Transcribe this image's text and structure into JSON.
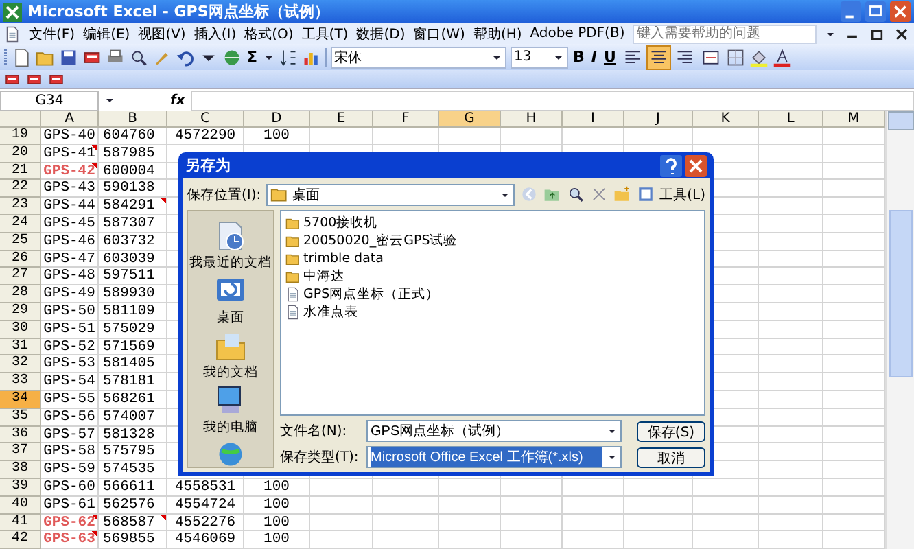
{
  "window": {
    "title": "Microsoft Excel - GPS网点坐标（试例）"
  },
  "menu": [
    "文件(F)",
    "编辑(E)",
    "视图(V)",
    "插入(I)",
    "格式(O)",
    "工具(T)",
    "数据(D)",
    "窗口(W)",
    "帮助(H)",
    "Adobe PDF(B)"
  ],
  "help_search": {
    "placeholder": "键入需要帮助的问题"
  },
  "standard_toolbar": {
    "sum_label": "Σ"
  },
  "formatting_toolbar": {
    "font": "宋体",
    "size": "13",
    "styles": [
      "B",
      "I",
      "U"
    ],
    "alignment": [
      {
        "selected": false
      },
      {
        "selected": true
      },
      {
        "selected": false
      },
      {
        "selected": false
      }
    ]
  },
  "formula_bar": {
    "name_box": "G34",
    "function_label": "fx"
  },
  "columns": [
    {
      "label": "A",
      "selected": false
    },
    {
      "label": "B",
      "selected": false
    },
    {
      "label": "C",
      "selected": false
    },
    {
      "label": "D",
      "selected": false
    },
    {
      "label": "E",
      "selected": false
    },
    {
      "label": "F",
      "selected": false
    },
    {
      "label": "G",
      "selected": true
    },
    {
      "label": "H",
      "selected": false
    },
    {
      "label": "I",
      "selected": false
    },
    {
      "label": "J",
      "selected": false
    },
    {
      "label": "K",
      "selected": false
    },
    {
      "label": "L",
      "selected": false
    },
    {
      "label": "M",
      "selected": false
    }
  ],
  "rows": [
    {
      "number": "19",
      "selected": false,
      "red": false,
      "cells": [
        {
          "text": "GPS-40",
          "comment": false
        },
        {
          "text": "604760",
          "comment": false
        },
        {
          "text": "4572290",
          "comment": false
        },
        {
          "text": "100",
          "comment": false
        }
      ]
    },
    {
      "number": "20",
      "selected": false,
      "red": false,
      "cells": [
        {
          "text": "GPS-41",
          "comment": true
        },
        {
          "text": "587985",
          "comment": false
        }
      ]
    },
    {
      "number": "21",
      "selected": false,
      "red": true,
      "cells": [
        {
          "text": "GPS-42",
          "comment": true
        },
        {
          "text": "600004",
          "comment": false
        }
      ]
    },
    {
      "number": "22",
      "selected": false,
      "red": false,
      "cells": [
        {
          "text": "GPS-43",
          "comment": false
        },
        {
          "text": "590138",
          "comment": false
        }
      ]
    },
    {
      "number": "23",
      "selected": false,
      "red": false,
      "cells": [
        {
          "text": "GPS-44",
          "comment": false
        },
        {
          "text": "584291",
          "comment": true
        }
      ]
    },
    {
      "number": "24",
      "selected": false,
      "red": false,
      "cells": [
        {
          "text": "GPS-45",
          "comment": false
        },
        {
          "text": "587307",
          "comment": false
        }
      ]
    },
    {
      "number": "25",
      "selected": false,
      "red": false,
      "cells": [
        {
          "text": "GPS-46",
          "comment": false
        },
        {
          "text": "603732",
          "comment": false
        }
      ]
    },
    {
      "number": "26",
      "selected": false,
      "red": false,
      "cells": [
        {
          "text": "GPS-47",
          "comment": false
        },
        {
          "text": "603039",
          "comment": false
        }
      ]
    },
    {
      "number": "27",
      "selected": false,
      "red": false,
      "cells": [
        {
          "text": "GPS-48",
          "comment": false
        },
        {
          "text": "597511",
          "comment": false
        }
      ]
    },
    {
      "number": "28",
      "selected": false,
      "red": false,
      "cells": [
        {
          "text": "GPS-49",
          "comment": false
        },
        {
          "text": "589930",
          "comment": false
        }
      ]
    },
    {
      "number": "29",
      "selected": false,
      "red": false,
      "cells": [
        {
          "text": "GPS-50",
          "comment": false
        },
        {
          "text": "581109",
          "comment": false
        }
      ]
    },
    {
      "number": "30",
      "selected": false,
      "red": false,
      "cells": [
        {
          "text": "GPS-51",
          "comment": false
        },
        {
          "text": "575029",
          "comment": false
        }
      ]
    },
    {
      "number": "31",
      "selected": false,
      "red": false,
      "cells": [
        {
          "text": "GPS-52",
          "comment": false
        },
        {
          "text": "571569",
          "comment": false
        }
      ]
    },
    {
      "number": "32",
      "selected": false,
      "red": false,
      "cells": [
        {
          "text": "GPS-53",
          "comment": false
        },
        {
          "text": "581405",
          "comment": false
        }
      ]
    },
    {
      "number": "33",
      "selected": false,
      "red": false,
      "cells": [
        {
          "text": "GPS-54",
          "comment": false
        },
        {
          "text": "578181",
          "comment": false
        }
      ]
    },
    {
      "number": "34",
      "selected": true,
      "red": false,
      "cells": [
        {
          "text": "GPS-55",
          "comment": false
        },
        {
          "text": "568261",
          "comment": false
        }
      ]
    },
    {
      "number": "35",
      "selected": false,
      "red": false,
      "cells": [
        {
          "text": "GPS-56",
          "comment": false
        },
        {
          "text": "574007",
          "comment": false
        }
      ]
    },
    {
      "number": "36",
      "selected": false,
      "red": false,
      "cells": [
        {
          "text": "GPS-57",
          "comment": false
        },
        {
          "text": "581328",
          "comment": false
        }
      ]
    },
    {
      "number": "37",
      "selected": false,
      "red": false,
      "cells": [
        {
          "text": "GPS-58",
          "comment": false
        },
        {
          "text": "575795",
          "comment": false
        }
      ]
    },
    {
      "number": "38",
      "selected": false,
      "red": false,
      "cells": [
        {
          "text": "GPS-59",
          "comment": false
        },
        {
          "text": "574535",
          "comment": false
        }
      ]
    },
    {
      "number": "39",
      "selected": false,
      "red": false,
      "cells": [
        {
          "text": "GPS-60",
          "comment": false
        },
        {
          "text": "566611",
          "comment": false
        },
        {
          "text": "4558531",
          "comment": false
        },
        {
          "text": "100",
          "comment": false
        }
      ]
    },
    {
      "number": "40",
      "selected": false,
      "red": false,
      "cells": [
        {
          "text": "GPS-61",
          "comment": false
        },
        {
          "text": "562576",
          "comment": false
        },
        {
          "text": "4554724",
          "comment": false
        },
        {
          "text": "100",
          "comment": false
        }
      ]
    },
    {
      "number": "41",
      "selected": false,
      "red": true,
      "cells": [
        {
          "text": "GPS-62",
          "comment": true
        },
        {
          "text": "568587",
          "comment": true
        },
        {
          "text": "4552276",
          "comment": false
        },
        {
          "text": "100",
          "comment": false
        }
      ]
    },
    {
      "number": "42",
      "selected": false,
      "red": true,
      "cells": [
        {
          "text": "GPS-63",
          "comment": true
        },
        {
          "text": "569855",
          "comment": false
        },
        {
          "text": "4546069",
          "comment": false
        },
        {
          "text": "100",
          "comment": false
        }
      ]
    }
  ],
  "dialog": {
    "title": "另存为",
    "location_label": "保存位置(I):",
    "location": "桌面",
    "tools_label": "工具(L)",
    "places": [
      {
        "label": "我最近的文档"
      },
      {
        "label": "桌面"
      },
      {
        "label": "我的文档"
      },
      {
        "label": "我的电脑"
      }
    ],
    "files": [
      {
        "name": "5700接收机",
        "kind": "folder"
      },
      {
        "name": "20050020_密云GPS试验",
        "kind": "folder"
      },
      {
        "name": "trimble data",
        "kind": "folder"
      },
      {
        "name": "中海达",
        "kind": "folder"
      },
      {
        "name": "GPS网点坐标（正式）",
        "kind": "workbook"
      },
      {
        "name": "水准点表",
        "kind": "workbook"
      }
    ],
    "filename_label": "文件名(N):",
    "filename": "GPS网点坐标（试例）",
    "type_label": "保存类型(T):",
    "type": "Microsoft Office Excel 工作簿(*.xls)",
    "save_button": "保存(S)",
    "cancel_button": "取消"
  }
}
